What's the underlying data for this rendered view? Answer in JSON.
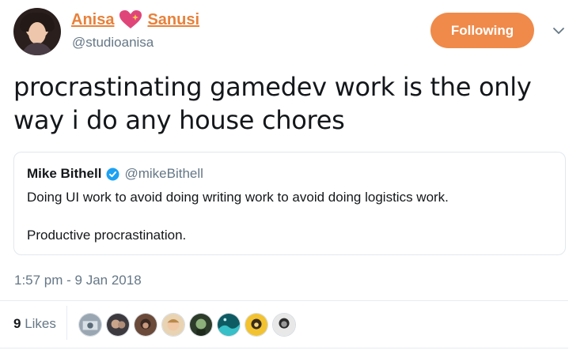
{
  "author": {
    "name_first": "Anisa",
    "name_last": "Sanusi",
    "handle": "@studioanisa",
    "name_color": "#e8813b"
  },
  "follow_button": {
    "label": "Following",
    "color": "#ef8a4a"
  },
  "menu_icon": "chevron-down-icon",
  "tweet": {
    "text": "procrastinating gamedev work is the only way i do any house chores"
  },
  "quoted": {
    "name": "Mike Bithell",
    "handle": "@mikeBithell",
    "line1": "Doing UI work to avoid doing writing work to avoid doing logistics work.",
    "line2": "Productive procrastination.",
    "verified_icon": "verified-badge-icon"
  },
  "timestamp": "1:57 pm - 9 Jan 2018",
  "likes": {
    "count": "9",
    "label": "Likes"
  },
  "likers": [
    {
      "name": "liker-1-avatar"
    },
    {
      "name": "liker-2-avatar"
    },
    {
      "name": "liker-3-avatar"
    },
    {
      "name": "liker-4-avatar"
    },
    {
      "name": "liker-5-avatar"
    },
    {
      "name": "liker-6-avatar"
    },
    {
      "name": "liker-7-avatar"
    },
    {
      "name": "liker-8-avatar"
    }
  ]
}
